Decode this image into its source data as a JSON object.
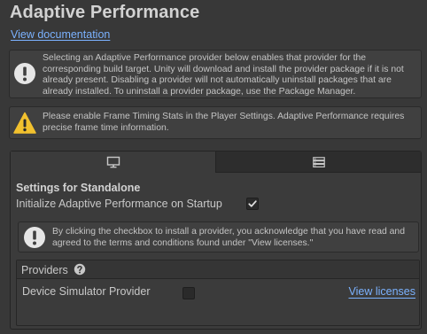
{
  "header": {
    "title": "Adaptive Performance",
    "documentation_link": "View documentation"
  },
  "info_box": {
    "icon": "info-icon",
    "text": "Selecting an Adaptive Performance provider below enables that provider for the corresponding build target. Unity will download and install the provider package if it is not already present. Disabling a provider will not automatically uninstall packages that are already installed. To uninstall a provider package, use the Package Manager."
  },
  "warning_box": {
    "icon": "warning-icon",
    "text": "Please enable Frame Timing Stats in the Player Settings. Adaptive Performance requires precise frame time information."
  },
  "platform_tabs": [
    {
      "icon": "desktop-monitor-icon",
      "active": true
    },
    {
      "icon": "server-icon",
      "active": false
    }
  ],
  "settings": {
    "title": "Settings for Standalone",
    "startup_label": "Initialize Adaptive Performance on Startup",
    "startup_checked": true
  },
  "consent_box": {
    "icon": "info-icon",
    "text": "By clicking the checkbox to install a provider, you acknowledge that you have read and agreed to the terms and conditions found under \"View licenses.\""
  },
  "providers": {
    "label": "Providers",
    "help_icon": "question-circle-icon",
    "items": [
      {
        "name": "Device Simulator Provider",
        "checked": false,
        "link": "View licenses"
      }
    ]
  },
  "colors": {
    "background": "#383838",
    "link": "#7bb2ff",
    "warning": "#f2c12e"
  }
}
